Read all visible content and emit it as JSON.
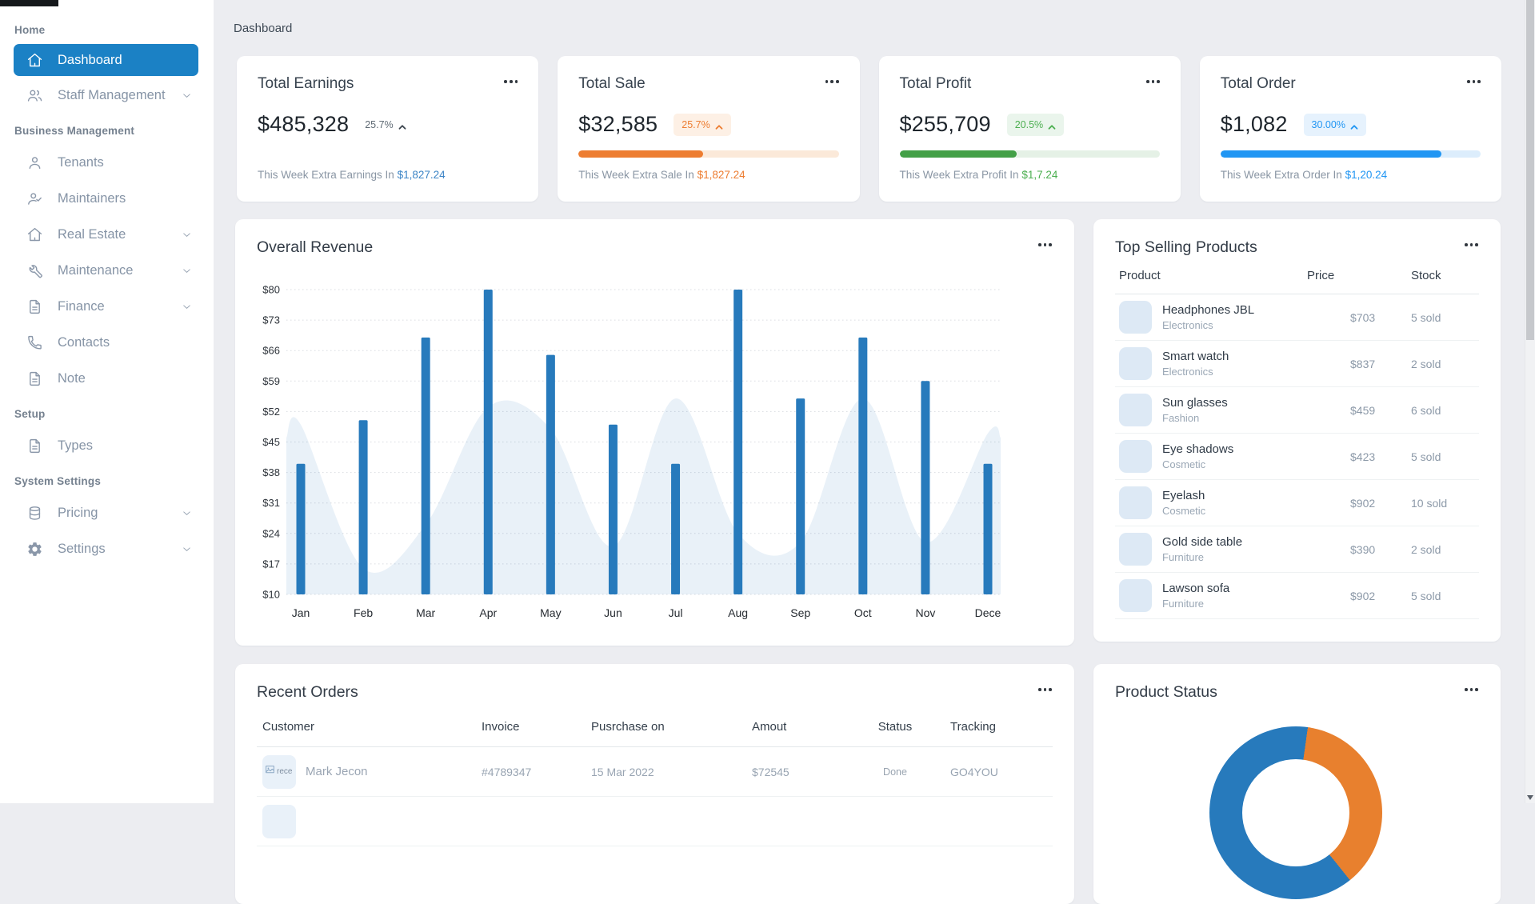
{
  "topbar": {
    "breadcrumb": "Dashboard"
  },
  "sidebar": {
    "sections": [
      {
        "label": "Home",
        "items": [
          {
            "label": "Dashboard",
            "icon": "home",
            "active": true,
            "chevron": false
          },
          {
            "label": "Staff Management",
            "icon": "users",
            "active": false,
            "chevron": true
          }
        ]
      },
      {
        "label": "Business Management",
        "items": [
          {
            "label": "Tenants",
            "icon": "person",
            "active": false,
            "chevron": false
          },
          {
            "label": "Maintainers",
            "icon": "person-check",
            "active": false,
            "chevron": false
          },
          {
            "label": "Real Estate",
            "icon": "home",
            "active": false,
            "chevron": true
          },
          {
            "label": "Maintenance",
            "icon": "wrench",
            "active": false,
            "chevron": true
          },
          {
            "label": "Finance",
            "icon": "file",
            "active": false,
            "chevron": true
          },
          {
            "label": "Contacts",
            "icon": "phone",
            "active": false,
            "chevron": false
          },
          {
            "label": "Note",
            "icon": "file",
            "active": false,
            "chevron": false
          }
        ]
      },
      {
        "label": "Setup",
        "items": [
          {
            "label": "Types",
            "icon": "file",
            "active": false,
            "chevron": false
          }
        ]
      },
      {
        "label": "System Settings",
        "items": [
          {
            "label": "Pricing",
            "icon": "database",
            "active": false,
            "chevron": true
          },
          {
            "label": "Settings",
            "icon": "gear",
            "active": false,
            "chevron": true
          }
        ]
      }
    ]
  },
  "stat_cards": [
    {
      "title": "Total Earnings",
      "value": "$485,328",
      "badge": "25.7%",
      "badge_bg": null,
      "badge_color": "#3c454e",
      "progress": null,
      "bar_color": null,
      "track_color": null,
      "footer_prefix": "This Week Extra Earnings In ",
      "footer_amount": "$1,827.24",
      "amount_color": "#3d85c6"
    },
    {
      "title": "Total Sale",
      "value": "$32,585",
      "badge": "25.7%",
      "badge_bg": "#fdf0e5",
      "badge_color": "#ed7d31",
      "progress": 48,
      "bar_color": "#ed7d31",
      "track_color": "#fbe9d9",
      "footer_prefix": "This Week Extra Sale In ",
      "footer_amount": "$1,827.24",
      "amount_color": "#ed7d31"
    },
    {
      "title": "Total Profit",
      "value": "$255,709",
      "badge": "20.5%",
      "badge_bg": "#eaf5ec",
      "badge_color": "#4caf50",
      "progress": 45,
      "bar_color": "#43a047",
      "track_color": "#e5f1e6",
      "footer_prefix": "This Week Extra Profit In ",
      "footer_amount": "$1,7.24",
      "amount_color": "#4caf50"
    },
    {
      "title": "Total Order",
      "value": "$1,082",
      "badge": "30.00%",
      "badge_bg": "#e6f2fd",
      "badge_color": "#2196f3",
      "progress": 85,
      "bar_color": "#2196f3",
      "track_color": "#dcedfc",
      "footer_prefix": "This Week Extra Order In ",
      "footer_amount": "$1,20.24",
      "amount_color": "#2196f3"
    }
  ],
  "top_products": {
    "title": "Top Selling Products",
    "columns": [
      "Product",
      "Price",
      "Stock"
    ],
    "rows": [
      {
        "name": "Headphones JBL",
        "category": "Electronics",
        "price": "$703",
        "stock": "5 sold"
      },
      {
        "name": "Smart watch",
        "category": "Electronics",
        "price": "$837",
        "stock": "2 sold"
      },
      {
        "name": "Sun glasses",
        "category": "Fashion",
        "price": "$459",
        "stock": "6 sold"
      },
      {
        "name": "Eye shadows",
        "category": "Cosmetic",
        "price": "$423",
        "stock": "5 sold"
      },
      {
        "name": "Eyelash",
        "category": "Cosmetic",
        "price": "$902",
        "stock": "10 sold"
      },
      {
        "name": "Gold side table",
        "category": "Furniture",
        "price": "$390",
        "stock": "2 sold"
      },
      {
        "name": "Lawson sofa",
        "category": "Furniture",
        "price": "$902",
        "stock": "5 sold"
      }
    ]
  },
  "recent_orders": {
    "title": "Recent Orders",
    "columns": [
      "Customer",
      "Invoice",
      "Pusrchase on",
      "Amout",
      "Status",
      "Tracking"
    ],
    "rows": [
      {
        "customer": "Mark Jecon",
        "image_alt": "rece",
        "invoice": "#4789347",
        "purchase_on": "15 Mar 2022",
        "amount": "$72545",
        "status": "Done",
        "tracking": "GO4YOU",
        "partial": false
      },
      {
        "customer": "",
        "image_alt": "",
        "invoice": "",
        "purchase_on": "",
        "amount": "",
        "status": "",
        "tracking": "",
        "partial": true
      }
    ]
  },
  "chart_data": [
    {
      "type": "bar",
      "title": "Overall Revenue",
      "categories": [
        "Jan",
        "Feb",
        "Mar",
        "Apr",
        "May",
        "Jun",
        "Jul",
        "Aug",
        "Sep",
        "Oct",
        "Nov",
        "Dece"
      ],
      "series": [
        {
          "name": "monthly-revenue",
          "type": "bar",
          "color": "#277abc",
          "values": [
            40,
            50,
            69,
            80,
            65,
            49,
            40,
            80,
            55,
            69,
            59,
            40
          ]
        },
        {
          "name": "background-wave",
          "type": "area",
          "color": "#277abc",
          "opacity": 0.1,
          "values": [
            49,
            16,
            26,
            53,
            48,
            21,
            55,
            24,
            22,
            55,
            22,
            47
          ]
        }
      ],
      "ylabel_prefix": "$",
      "yticks": [
        10,
        17,
        24,
        31,
        38,
        45,
        52,
        59,
        66,
        73,
        80
      ],
      "ylim": [
        10,
        80
      ],
      "grid": "dotted-horizontal",
      "legend": "none"
    },
    {
      "type": "pie",
      "donut": true,
      "title": "Product Status",
      "start_angle_deg": 8,
      "segments": [
        {
          "color": "#e8802e",
          "percent": 37
        },
        {
          "color": "#277abc",
          "percent": 63
        }
      ]
    }
  ]
}
